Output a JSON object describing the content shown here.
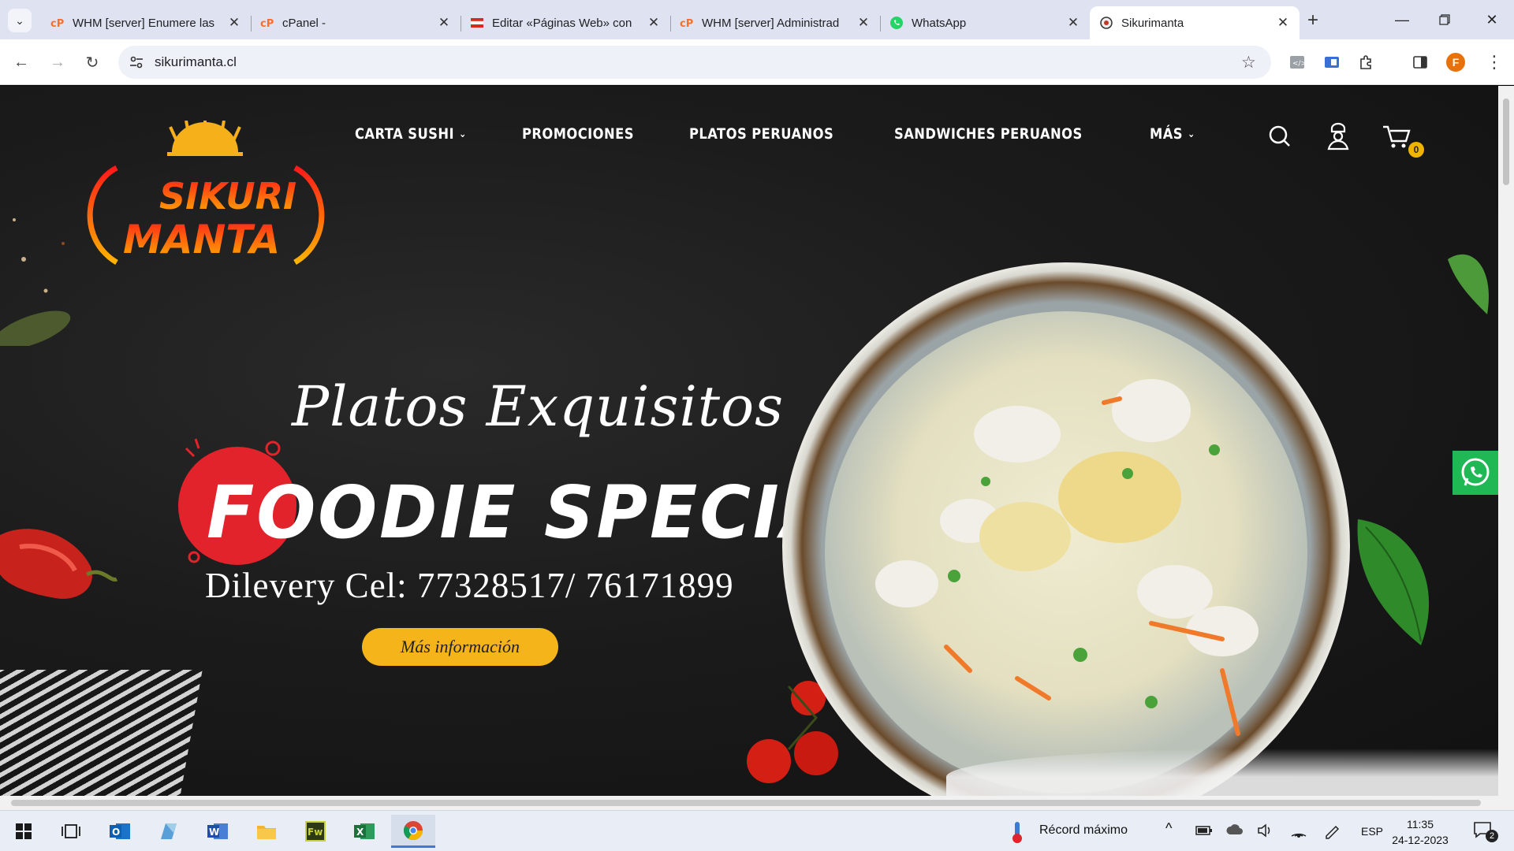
{
  "browser": {
    "tabs": [
      {
        "title": "WHM [server] Enumere las",
        "icon": "cpanel-icon",
        "active": false
      },
      {
        "title": "cPanel -",
        "icon": "cpanel-icon",
        "active": false
      },
      {
        "title": "Editar «Páginas Web» con",
        "icon": "flag-icon",
        "active": false
      },
      {
        "title": "WHM [server] Administrad",
        "icon": "cpanel-icon",
        "active": false
      },
      {
        "title": "WhatsApp",
        "icon": "whatsapp-icon",
        "active": false
      },
      {
        "title": "Sikurimanta",
        "icon": "site-icon",
        "active": true
      }
    ],
    "url": "sikurimanta.cl",
    "profile_initial": "F"
  },
  "site": {
    "logo_line1": "SIKURI",
    "logo_line2": "MANTA",
    "nav": [
      {
        "label": "CARTA SUSHI",
        "dropdown": true
      },
      {
        "label": "PROMOCIONES",
        "dropdown": false
      },
      {
        "label": "PLATOS PERUANOS",
        "dropdown": false
      },
      {
        "label": "SANDWICHES PERUANOS",
        "dropdown": false
      },
      {
        "label": "MÁS",
        "dropdown": true
      }
    ],
    "cart_count": "0",
    "hero": {
      "script_title": "Platos Exquisitos",
      "headline": "FOODIE SPECIAL",
      "delivery": "Dilevery Cel: 77328517/ 76171899",
      "cta": "Más información"
    },
    "colors": {
      "accent": "#f4b41a",
      "red": "#e3232b",
      "whatsapp": "#1fb855"
    }
  },
  "taskbar": {
    "weather": "Récord máximo",
    "lang": "ESP",
    "time": "11:35",
    "date": "24-12-2023",
    "notifications": "2"
  }
}
